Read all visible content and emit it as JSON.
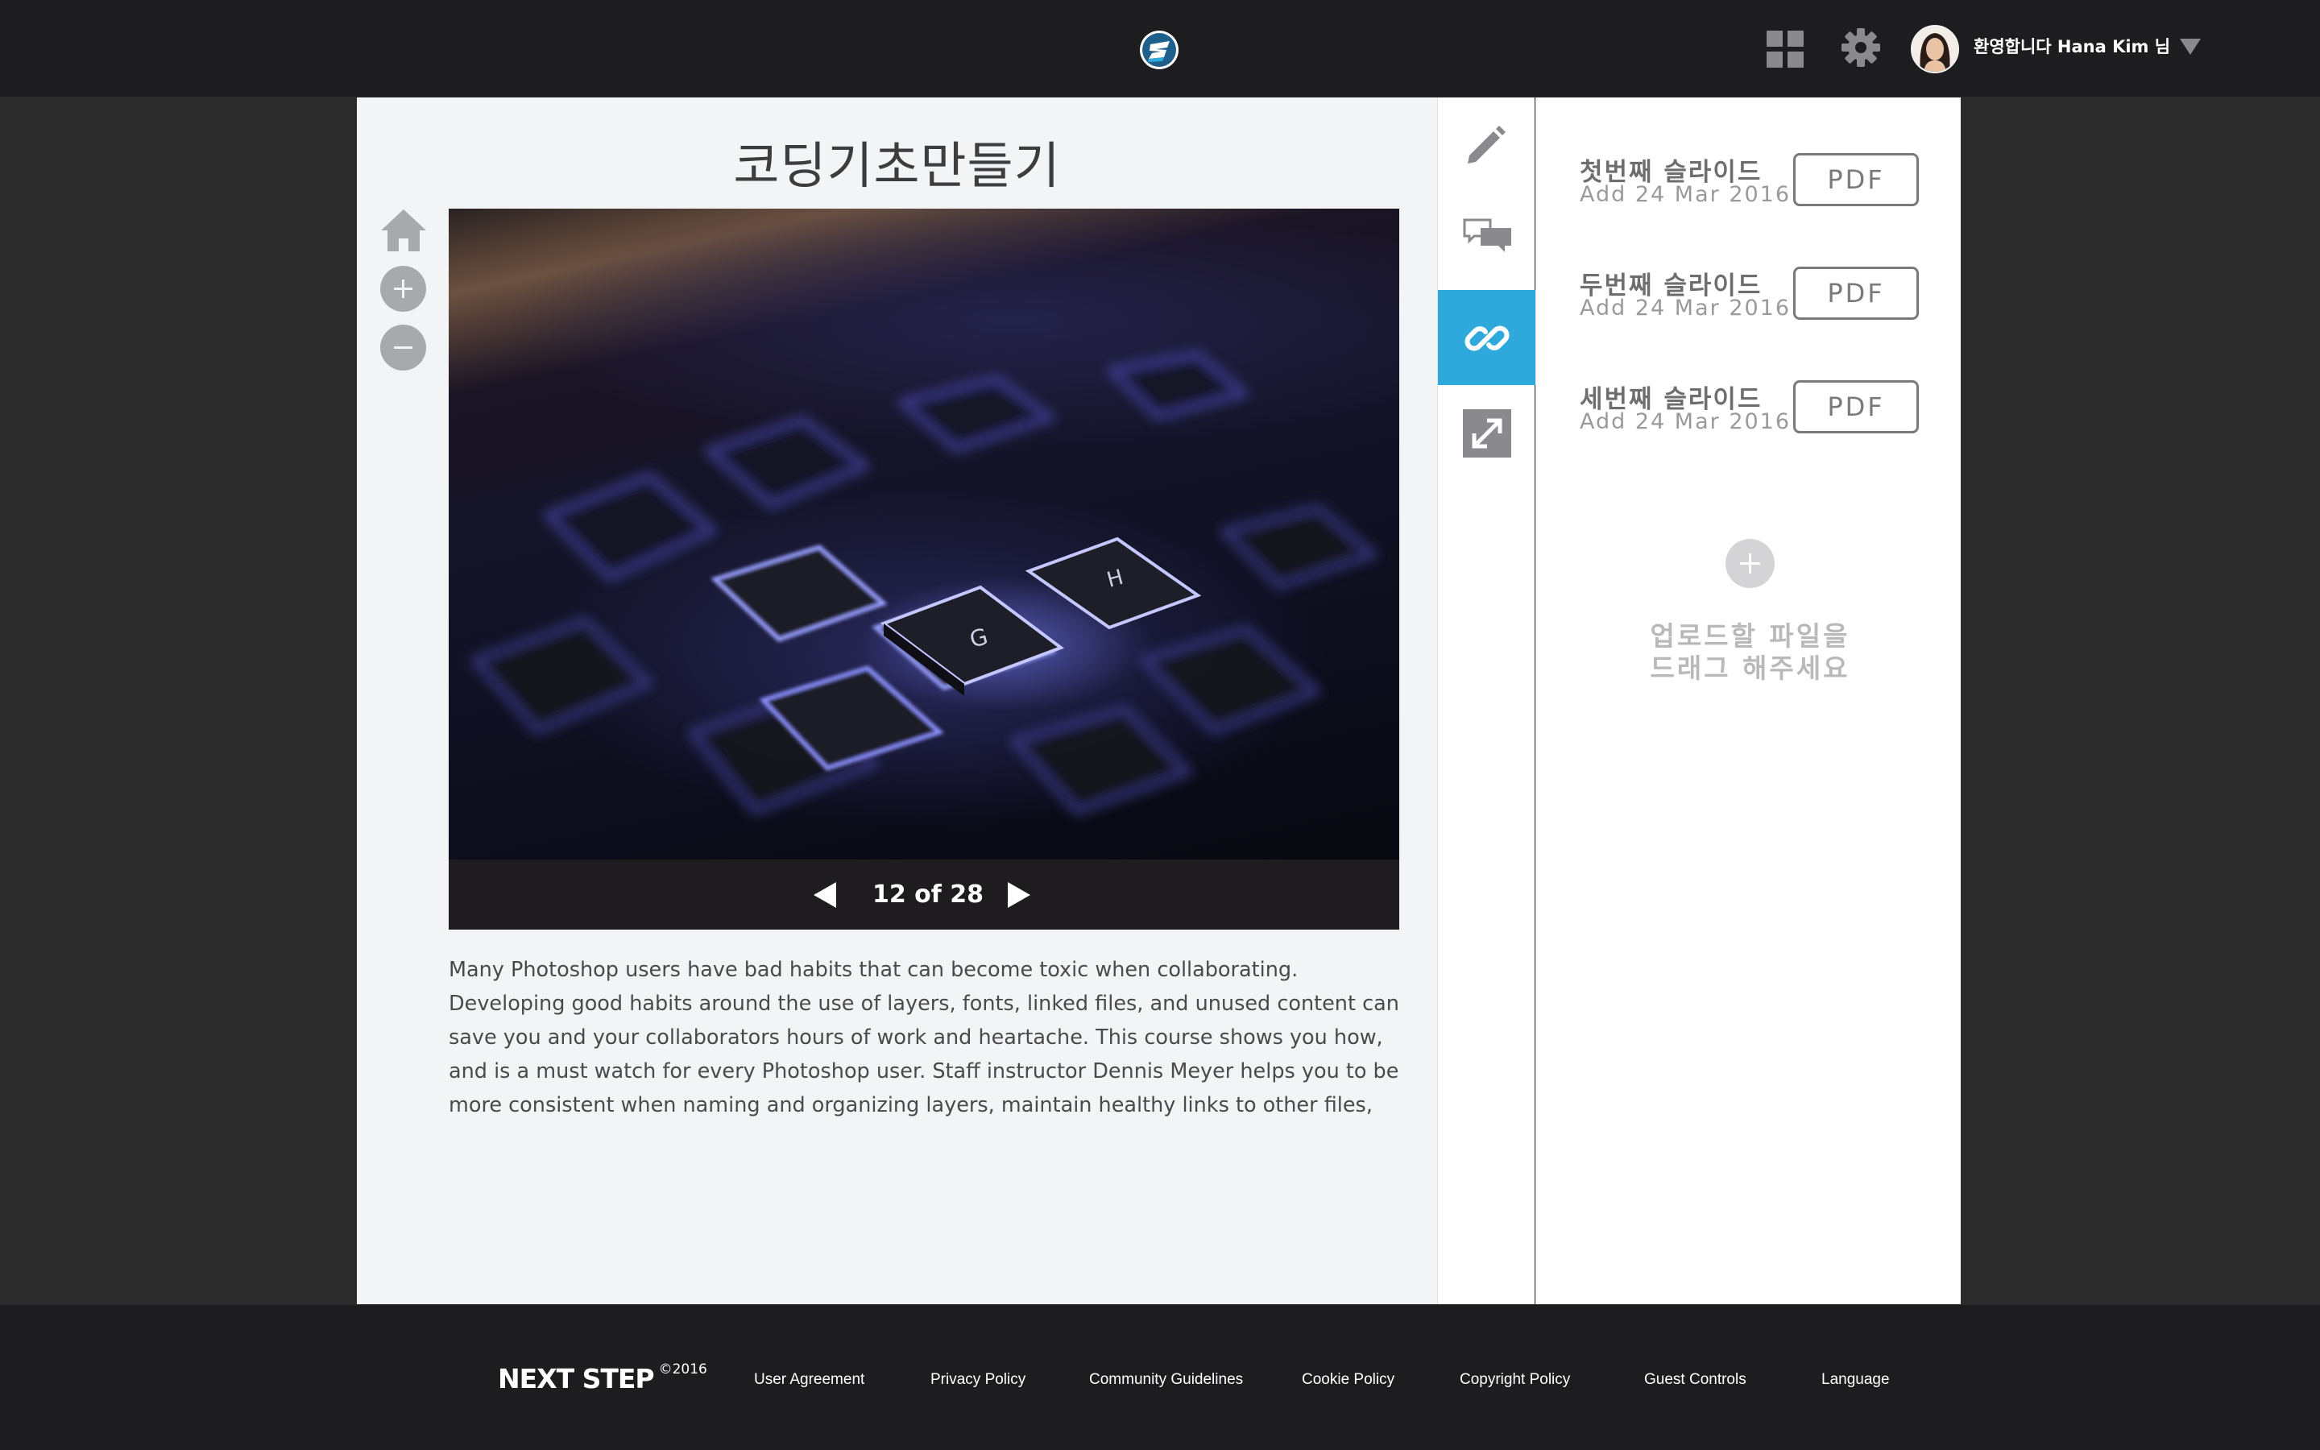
{
  "header": {
    "welcome_text": "환영합니다 Hana Kim 님",
    "icons": [
      "logo-icon",
      "grid-icon",
      "gear-icon",
      "avatar",
      "chevron-down-icon"
    ]
  },
  "viewer": {
    "title": "코딩기초만들기",
    "page_counter": "12 of 28",
    "description": "Many Photoshop users have bad habits that can become toxic when collaborating. Developing good habits around the use of layers, fonts, linked files, and unused content can save you and your collaborators hours of work and heartache. This course shows you how, and is a must watch for every Photoshop user. Staff instructor Dennis Meyer helps you to be more consistent when naming and organizing layers, maintain healthy links to other files, keep assets in sync,"
  },
  "rail": {
    "items": [
      {
        "icon": "pencil-icon",
        "active": false
      },
      {
        "icon": "chat-bubbles-icon",
        "active": false
      },
      {
        "icon": "link-icon",
        "active": true
      },
      {
        "icon": "expand-icon",
        "active": false
      }
    ]
  },
  "slides": {
    "items": [
      {
        "name": "첫번째 슬라이드",
        "date": "Add 24 Mar 2016",
        "button": "PDF"
      },
      {
        "name": "두번째 슬라이드",
        "date": "Add 24 Mar 2016",
        "button": "PDF"
      },
      {
        "name": "세번째 슬라이드",
        "date": "Add 24 Mar 2016",
        "button": "PDF"
      }
    ],
    "upload_hint": "업로드할 파일을\n드래그 해주세요"
  },
  "footer": {
    "brand": "NEXT STEP",
    "year": "©2016",
    "links": [
      "User Agreement",
      "Privacy Policy",
      "Community Guidelines",
      "Cookie Policy",
      "Copyright Policy",
      "Guest Controls",
      "Language"
    ]
  },
  "colors": {
    "accent": "#2fa8dc",
    "topbar": "#1d1d1f",
    "background": "#2b2b2b",
    "panel": "#f3f4f6"
  }
}
